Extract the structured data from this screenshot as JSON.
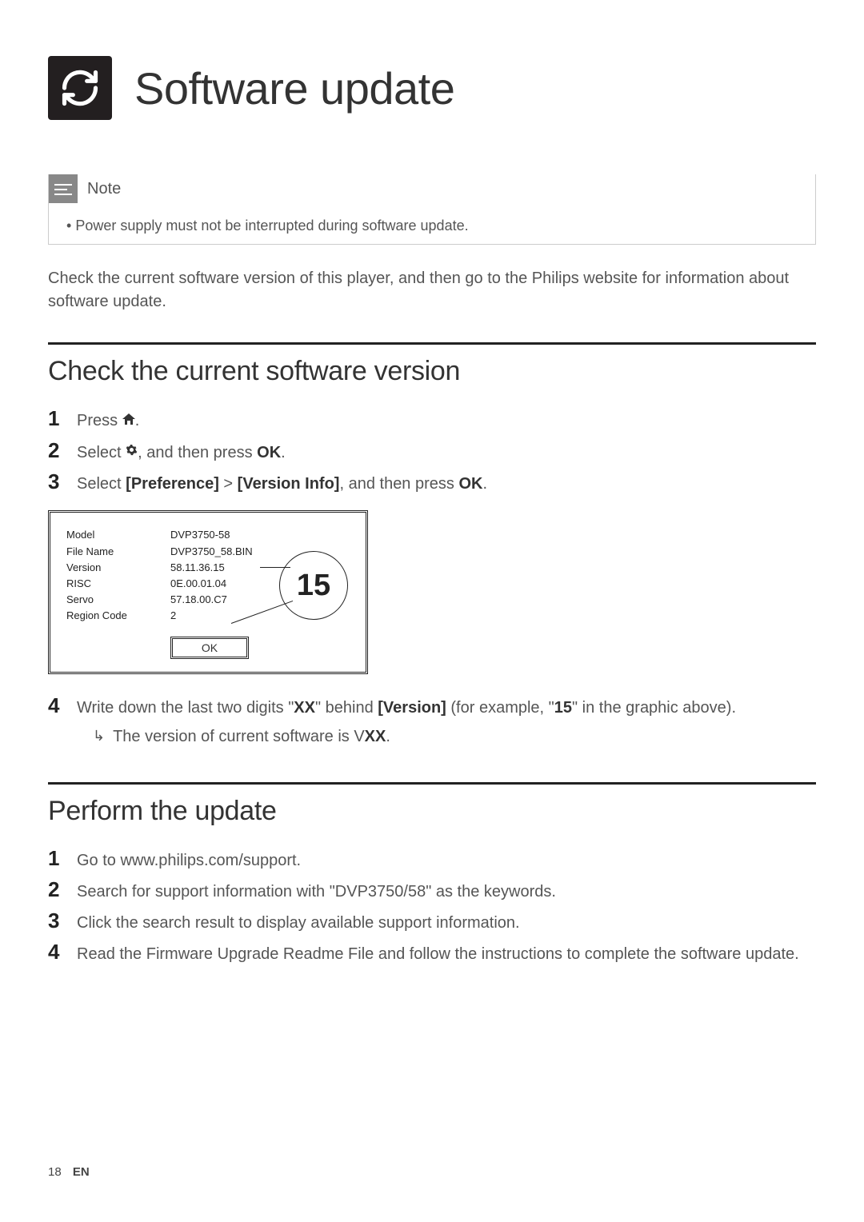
{
  "header": {
    "title": "Software update"
  },
  "note": {
    "label": "Note",
    "items": [
      "Power supply must not be interrupted during software update."
    ]
  },
  "lead": "Check the current software version of this player, and then go to the Philips website for information about software update.",
  "section1": {
    "title": "Check the current software version",
    "steps": {
      "s1_pre": "Press ",
      "s1_post": ".",
      "s2_pre": "Select ",
      "s2_mid": ", and then press ",
      "s2_ok": "OK",
      "s2_post": ".",
      "s3_pre": "Select ",
      "s3_pref": "[Preference]",
      "s3_gt": " > ",
      "s3_ver": "[Version Info]",
      "s3_mid": ", and then press ",
      "s3_ok": "OK",
      "s3_post": ".",
      "s4_pre": "Write down the last two digits \"",
      "s4_xx": "XX",
      "s4_mid1": "\" behind ",
      "s4_ver": "[Version]",
      "s4_mid2": " (for example, \"",
      "s4_15": "15",
      "s4_post": "\" in the graphic above).",
      "s4_sub_pre": "The version of current software is V",
      "s4_sub_xx": "XX",
      "s4_sub_post": "."
    }
  },
  "panel": {
    "labels": {
      "model": "Model",
      "file": "File Name",
      "version": "Version",
      "risc": "RISC",
      "servo": "Servo",
      "region": "Region Code"
    },
    "values": {
      "model": "DVP3750-58",
      "file": "DVP3750_58.BIN",
      "version": "58.11.36.15",
      "risc": "0E.00.01.04",
      "servo": "57.18.00.C7",
      "region": "2"
    },
    "ok": "OK",
    "callout": "15"
  },
  "section2": {
    "title": "Perform the update",
    "steps": {
      "s1": "Go to www.philips.com/support.",
      "s2": "Search for support information with \"DVP3750/58\" as the keywords.",
      "s3": "Click the search result to display available support information.",
      "s4": "Read the Firmware Upgrade Readme File and follow the instructions to complete the software update."
    }
  },
  "footer": {
    "page": "18",
    "lang": "EN"
  }
}
